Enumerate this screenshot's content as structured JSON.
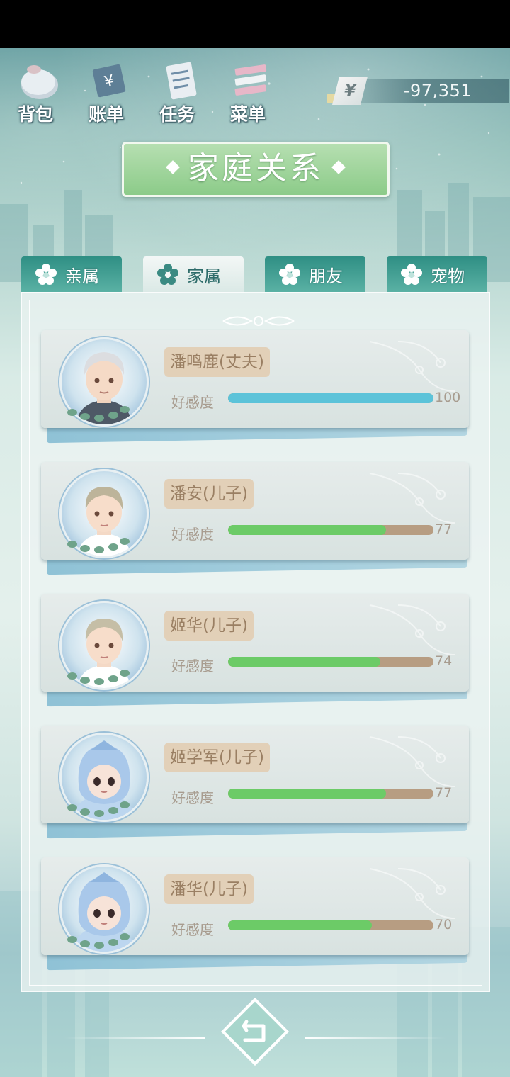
{
  "toolbar": {
    "items": [
      {
        "label": "背包",
        "icon": "bag-icon"
      },
      {
        "label": "账单",
        "icon": "bill-icon"
      },
      {
        "label": "任务",
        "icon": "task-icon"
      },
      {
        "label": "菜单",
        "icon": "menu-icon"
      }
    ]
  },
  "money": {
    "currency_symbol": "¥",
    "value": "-97,351"
  },
  "title": "家庭关系",
  "tabs": [
    {
      "label": "亲属",
      "active": false
    },
    {
      "label": "家属",
      "active": true
    },
    {
      "label": "朋友",
      "active": false
    },
    {
      "label": "宠物",
      "active": false
    }
  ],
  "affection_label": "好感度",
  "members": [
    {
      "name": "潘鸣鹿(丈夫)",
      "affection": 100,
      "affection_text": "100",
      "bar_color": "#5cc3d9"
    },
    {
      "name": "潘安(儿子)",
      "affection": 77,
      "affection_text": "77",
      "bar_color": "#6ccb67"
    },
    {
      "name": "姬华(儿子)",
      "affection": 74,
      "affection_text": "74",
      "bar_color": "#6ccb67"
    },
    {
      "name": "姬学军(儿子)",
      "affection": 77,
      "affection_text": "77",
      "bar_color": "#6ccb67"
    },
    {
      "name": "潘华(儿子)",
      "affection": 70,
      "affection_text": "70",
      "bar_color": "#6ccb67"
    }
  ]
}
